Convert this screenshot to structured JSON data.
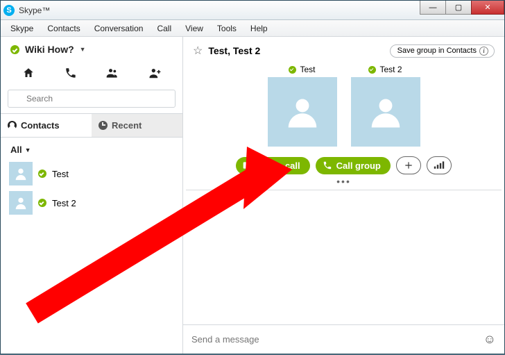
{
  "window": {
    "title": "Skype™"
  },
  "menu": [
    "Skype",
    "Contacts",
    "Conversation",
    "Call",
    "View",
    "Tools",
    "Help"
  ],
  "sidebar": {
    "username": "Wiki How?",
    "search_placeholder": "Search",
    "tabs": {
      "contacts": "Contacts",
      "recent": "Recent"
    },
    "filter_label": "All",
    "contacts": [
      {
        "name": "Test"
      },
      {
        "name": "Test 2"
      }
    ]
  },
  "conversation": {
    "title": "Test, Test 2",
    "save_button": "Save group in Contacts",
    "participants": [
      {
        "name": "Test"
      },
      {
        "name": "Test 2"
      }
    ],
    "video_call": "Video call",
    "call_group": "Call group",
    "message_placeholder": "Send a message"
  },
  "colors": {
    "accent_green": "#7db700",
    "avatar_bg": "#b9d9e8"
  }
}
